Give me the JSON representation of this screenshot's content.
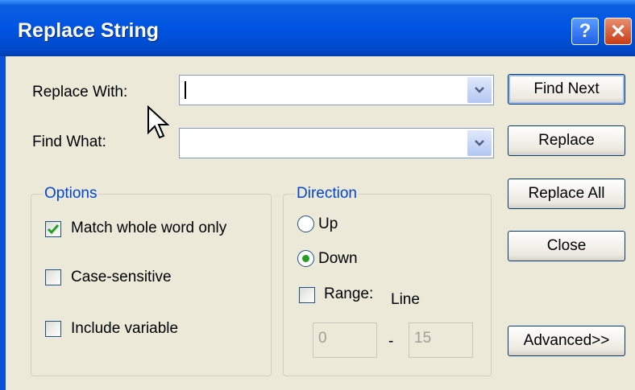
{
  "window": {
    "title": "Replace String",
    "help_label": "?",
    "close_label": "✕"
  },
  "fields": {
    "replace_with": {
      "label": "Replace With:",
      "value": ""
    },
    "find_what": {
      "label": "Find What:",
      "value": ""
    }
  },
  "buttons": {
    "find_next": "Find Next",
    "replace": "Replace",
    "replace_all": "Replace All",
    "close": "Close",
    "advanced": "Advanced>>"
  },
  "options": {
    "title": "Options",
    "match_whole_word": {
      "label": "Match whole word only",
      "checked": true
    },
    "case_sensitive": {
      "label": "Case-sensitive",
      "checked": false
    },
    "include_variable": {
      "label": "Include variable",
      "checked": false
    }
  },
  "direction": {
    "title": "Direction",
    "up_label": "Up",
    "down_label": "Down",
    "selected": "Down",
    "range_label": "Range:",
    "line_label": "Line",
    "range_checked": false,
    "range_from": "0",
    "range_separator": "-",
    "range_to": "15"
  },
  "colors": {
    "titlebar": "#0054e3",
    "group_title": "#0046d5",
    "check_mark": "#21a121"
  }
}
